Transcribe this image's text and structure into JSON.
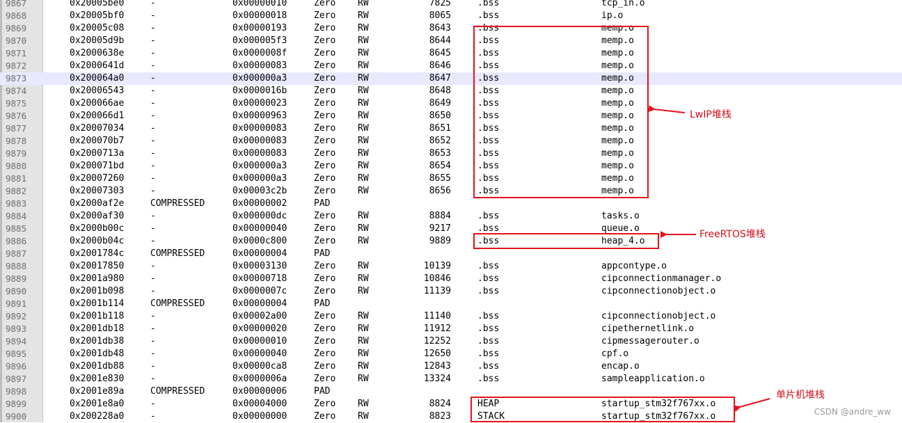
{
  "rows": [
    {
      "ln": "9867",
      "addr": "0x20005be0",
      "attr": "-",
      "size": "0x00000010",
      "type": "Zero",
      "access": "RW",
      "idx": "7825",
      "section": ".bss",
      "object": "tcp_in.o"
    },
    {
      "ln": "9868",
      "addr": "0x20005bf0",
      "attr": "-",
      "size": "0x00000018",
      "type": "Zero",
      "access": "RW",
      "idx": "8065",
      "section": ".bss",
      "object": "ip.o"
    },
    {
      "ln": "9869",
      "addr": "0x20005c08",
      "attr": "-",
      "size": "0x00000193",
      "type": "Zero",
      "access": "RW",
      "idx": "8643",
      "section": ".bss",
      "object": "memp.o"
    },
    {
      "ln": "9870",
      "addr": "0x20005d9b",
      "attr": "-",
      "size": "0x000005f3",
      "type": "Zero",
      "access": "RW",
      "idx": "8644",
      "section": ".bss",
      "object": "memp.o"
    },
    {
      "ln": "9871",
      "addr": "0x2000638e",
      "attr": "-",
      "size": "0x0000008f",
      "type": "Zero",
      "access": "RW",
      "idx": "8645",
      "section": ".bss",
      "object": "memp.o"
    },
    {
      "ln": "9872",
      "addr": "0x2000641d",
      "attr": "-",
      "size": "0x00000083",
      "type": "Zero",
      "access": "RW",
      "idx": "8646",
      "section": ".bss",
      "object": "memp.o"
    },
    {
      "ln": "9873",
      "addr": "0x200064a0",
      "attr": "-",
      "size": "0x000000a3",
      "type": "Zero",
      "access": "RW",
      "idx": "8647",
      "section": ".bss",
      "object": "memp.o",
      "current": true
    },
    {
      "ln": "9874",
      "addr": "0x20006543",
      "attr": "-",
      "size": "0x0000016b",
      "type": "Zero",
      "access": "RW",
      "idx": "8648",
      "section": ".bss",
      "object": "memp.o"
    },
    {
      "ln": "9875",
      "addr": "0x200066ae",
      "attr": "-",
      "size": "0x00000023",
      "type": "Zero",
      "access": "RW",
      "idx": "8649",
      "section": ".bss",
      "object": "memp.o"
    },
    {
      "ln": "9876",
      "addr": "0x200066d1",
      "attr": "-",
      "size": "0x00000963",
      "type": "Zero",
      "access": "RW",
      "idx": "8650",
      "section": ".bss",
      "object": "memp.o"
    },
    {
      "ln": "9877",
      "addr": "0x20007034",
      "attr": "-",
      "size": "0x00000083",
      "type": "Zero",
      "access": "RW",
      "idx": "8651",
      "section": ".bss",
      "object": "memp.o"
    },
    {
      "ln": "9878",
      "addr": "0x200070b7",
      "attr": "-",
      "size": "0x00000083",
      "type": "Zero",
      "access": "RW",
      "idx": "8652",
      "section": ".bss",
      "object": "memp.o"
    },
    {
      "ln": "9879",
      "addr": "0x2000713a",
      "attr": "-",
      "size": "0x00000083",
      "type": "Zero",
      "access": "RW",
      "idx": "8653",
      "section": ".bss",
      "object": "memp.o"
    },
    {
      "ln": "9880",
      "addr": "0x200071bd",
      "attr": "-",
      "size": "0x000000a3",
      "type": "Zero",
      "access": "RW",
      "idx": "8654",
      "section": ".bss",
      "object": "memp.o"
    },
    {
      "ln": "9881",
      "addr": "0x20007260",
      "attr": "-",
      "size": "0x000000a3",
      "type": "Zero",
      "access": "RW",
      "idx": "8655",
      "section": ".bss",
      "object": "memp.o"
    },
    {
      "ln": "9882",
      "addr": "0x20007303",
      "attr": "-",
      "size": "0x00003c2b",
      "type": "Zero",
      "access": "RW",
      "idx": "8656",
      "section": ".bss",
      "object": "memp.o"
    },
    {
      "ln": "9883",
      "addr": "0x2000af2e",
      "attr": "COMPRESSED",
      "size": "0x00000002",
      "type": "PAD",
      "access": "",
      "idx": "",
      "section": "",
      "object": ""
    },
    {
      "ln": "9884",
      "addr": "0x2000af30",
      "attr": "-",
      "size": "0x000000dc",
      "type": "Zero",
      "access": "RW",
      "idx": "8884",
      "section": ".bss",
      "object": "tasks.o"
    },
    {
      "ln": "9885",
      "addr": "0x2000b00c",
      "attr": "-",
      "size": "0x00000040",
      "type": "Zero",
      "access": "RW",
      "idx": "9217",
      "section": ".bss",
      "object": "queue.o"
    },
    {
      "ln": "9886",
      "addr": "0x2000b04c",
      "attr": "-",
      "size": "0x0000c800",
      "type": "Zero",
      "access": "RW",
      "idx": "9889",
      "section": ".bss",
      "object": "heap_4.o"
    },
    {
      "ln": "9887",
      "addr": "0x2001784c",
      "attr": "COMPRESSED",
      "size": "0x00000004",
      "type": "PAD",
      "access": "",
      "idx": "",
      "section": "",
      "object": ""
    },
    {
      "ln": "9888",
      "addr": "0x20017850",
      "attr": "-",
      "size": "0x00003130",
      "type": "Zero",
      "access": "RW",
      "idx": "10139",
      "section": ".bss",
      "object": "appcontype.o"
    },
    {
      "ln": "9889",
      "addr": "0x2001a980",
      "attr": "-",
      "size": "0x00000718",
      "type": "Zero",
      "access": "RW",
      "idx": "10846",
      "section": ".bss",
      "object": "cipconnectionmanager.o"
    },
    {
      "ln": "9890",
      "addr": "0x2001b098",
      "attr": "-",
      "size": "0x0000007c",
      "type": "Zero",
      "access": "RW",
      "idx": "11139",
      "section": ".bss",
      "object": "cipconnectionobject.o"
    },
    {
      "ln": "9891",
      "addr": "0x2001b114",
      "attr": "COMPRESSED",
      "size": "0x00000004",
      "type": "PAD",
      "access": "",
      "idx": "",
      "section": "",
      "object": ""
    },
    {
      "ln": "9892",
      "addr": "0x2001b118",
      "attr": "-",
      "size": "0x00002a00",
      "type": "Zero",
      "access": "RW",
      "idx": "11140",
      "section": ".bss",
      "object": "cipconnectionobject.o"
    },
    {
      "ln": "9893",
      "addr": "0x2001db18",
      "attr": "-",
      "size": "0x00000020",
      "type": "Zero",
      "access": "RW",
      "idx": "11912",
      "section": ".bss",
      "object": "cipethernetlink.o"
    },
    {
      "ln": "9894",
      "addr": "0x2001db38",
      "attr": "-",
      "size": "0x00000010",
      "type": "Zero",
      "access": "RW",
      "idx": "12252",
      "section": ".bss",
      "object": "cipmessagerouter.o"
    },
    {
      "ln": "9895",
      "addr": "0x2001db48",
      "attr": "-",
      "size": "0x00000040",
      "type": "Zero",
      "access": "RW",
      "idx": "12650",
      "section": ".bss",
      "object": "cpf.o"
    },
    {
      "ln": "9896",
      "addr": "0x2001db88",
      "attr": "-",
      "size": "0x00000ca8",
      "type": "Zero",
      "access": "RW",
      "idx": "12843",
      "section": ".bss",
      "object": "encap.o"
    },
    {
      "ln": "9897",
      "addr": "0x2001e830",
      "attr": "-",
      "size": "0x0000006a",
      "type": "Zero",
      "access": "RW",
      "idx": "13324",
      "section": ".bss",
      "object": "sampleapplication.o"
    },
    {
      "ln": "9898",
      "addr": "0x2001e89a",
      "attr": "COMPRESSED",
      "size": "0x00000006",
      "type": "PAD",
      "access": "",
      "idx": "",
      "section": "",
      "object": ""
    },
    {
      "ln": "9899",
      "addr": "0x2001e8a0",
      "attr": "-",
      "size": "0x00004000",
      "type": "Zero",
      "access": "RW",
      "idx": "8824",
      "section": "HEAP",
      "object": "startup_stm32f767xx.o"
    },
    {
      "ln": "9900",
      "addr": "0x200228a0",
      "attr": "-",
      "size": "0x00000000",
      "type": "Zero",
      "access": "RW",
      "idx": "8823",
      "section": "STACK",
      "object": "startup_stm32f767xx.o"
    }
  ],
  "annotations": {
    "lwip_label": "LwIP堆栈",
    "freertos_label": "FreeRTOS堆栈",
    "mcu_label": "单片机堆栈",
    "accent_color": "#e8101a"
  },
  "watermark": "CSDN @andre_ww"
}
